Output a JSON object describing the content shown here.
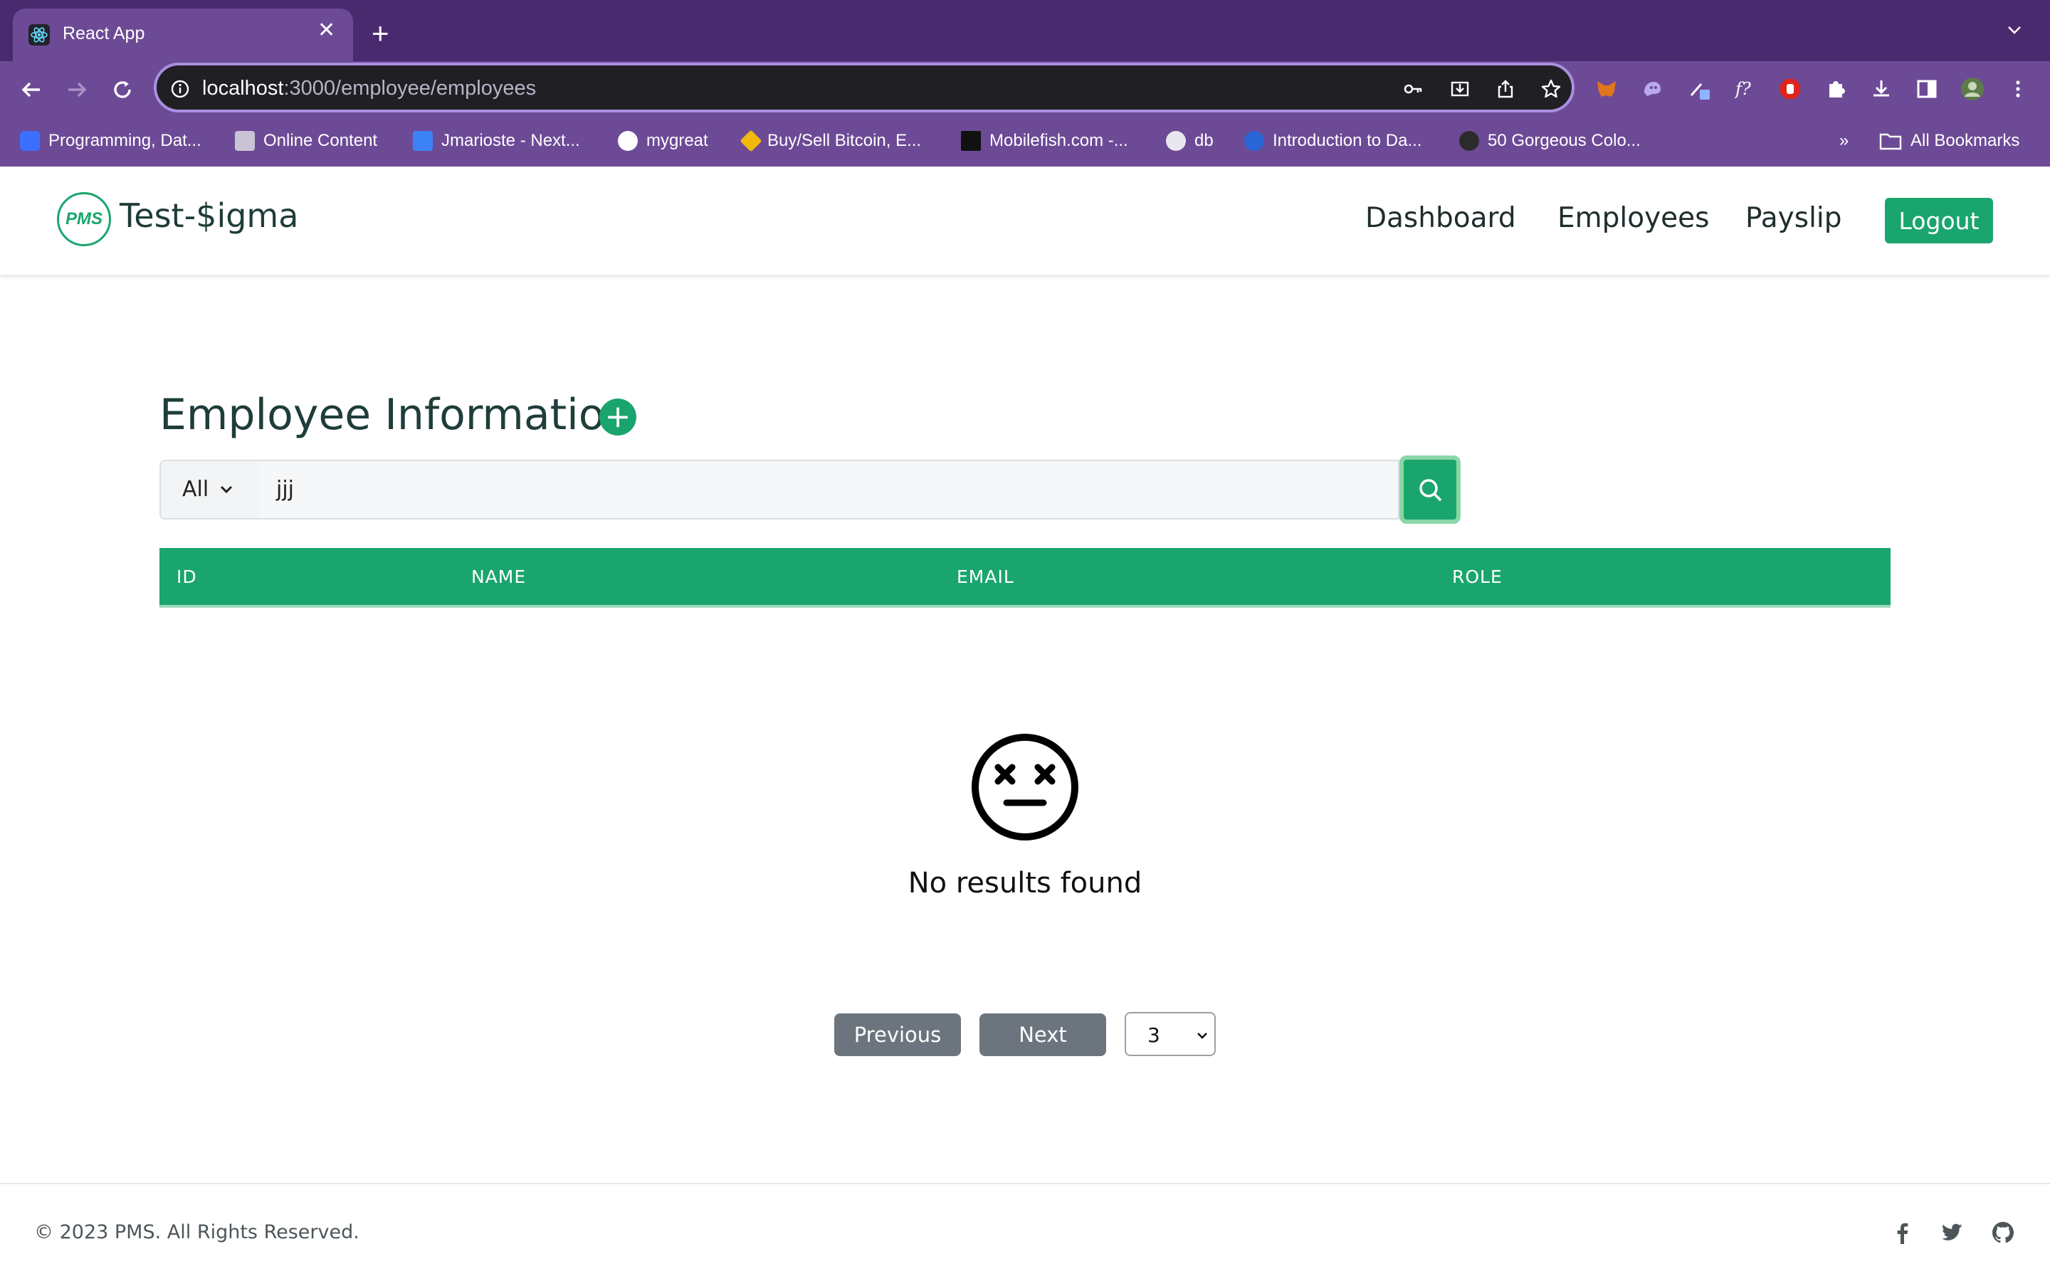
{
  "browser": {
    "tab_title": "React App",
    "tab_close": "✕",
    "new_tab": "+",
    "url_host": "localhost",
    "url_rest": ":3000/employee/employees",
    "bookmarks": [
      {
        "label": "Programming, Dat...",
        "color": "#3b6fff"
      },
      {
        "label": "Online Content",
        "color": "#c9c3d6"
      },
      {
        "label": "Jmarioste - Next...",
        "color": "#3b82f6"
      },
      {
        "label": "mygreat",
        "color": "#ffffff"
      },
      {
        "label": "Buy/Sell Bitcoin, E...",
        "color": "#f0b90b"
      },
      {
        "label": "Mobilefish.com -...",
        "color": "#111111"
      },
      {
        "label": "db",
        "color": "#e9e6ef"
      },
      {
        "label": "Introduction to Da...",
        "color": "#2a66d6"
      },
      {
        "label": "50 Gorgeous Colo...",
        "color": "#2b2b2b"
      }
    ],
    "bookmarks_overflow": "»",
    "all_bookmarks": "All Bookmarks"
  },
  "app": {
    "logo_text": "PMS",
    "brand": "Test-$igma",
    "nav": {
      "dashboard": "Dashboard",
      "employees": "Employees",
      "payslip": "Payslip",
      "logout": "Logout"
    },
    "accent_color": "#1aa56e"
  },
  "main": {
    "title": "Employee Information",
    "add_icon": "+",
    "filter_value": "All",
    "search_value": "jjj",
    "table": {
      "columns": [
        "ID",
        "NAME",
        "EMAIL",
        "ROLE"
      ],
      "rows": []
    },
    "empty_state": {
      "icon": "dizzy-face-icon",
      "message": "No results found"
    },
    "pagination": {
      "previous": "Previous",
      "next": "Next",
      "page_size": "3"
    }
  },
  "footer": {
    "copyright": "© 2023 PMS. All Rights Reserved.",
    "social": [
      "facebook-icon",
      "twitter-icon",
      "github-icon"
    ]
  }
}
